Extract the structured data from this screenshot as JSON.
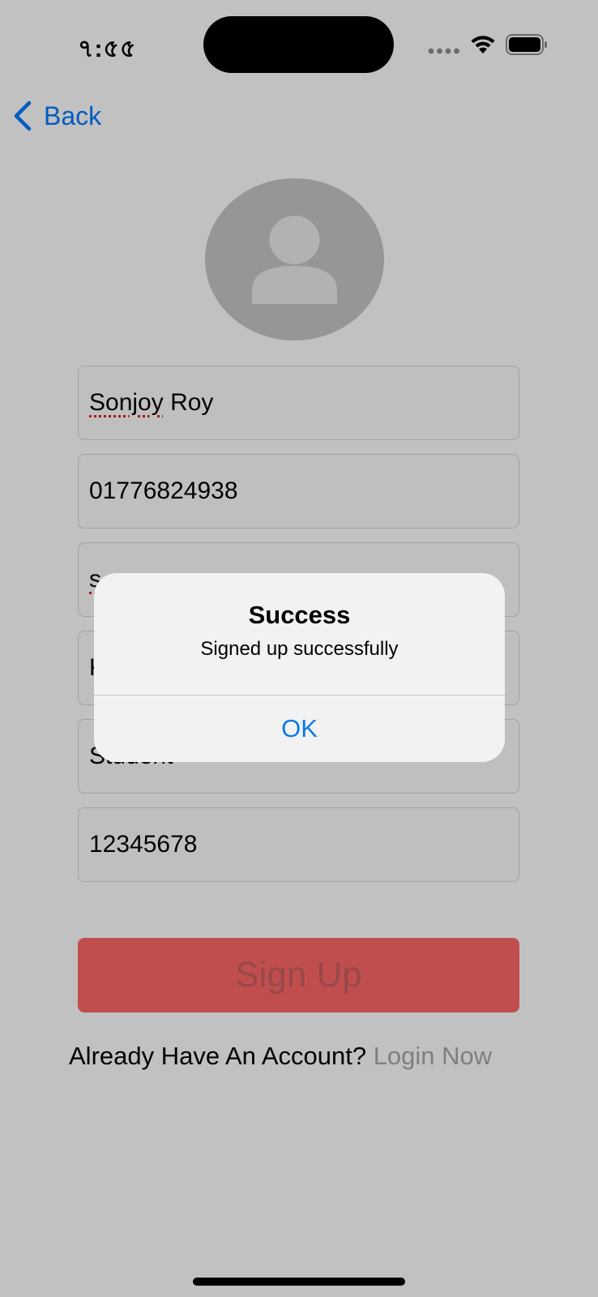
{
  "status_bar": {
    "time": "৭:৫৫",
    "signal_icon": "cellular-signal-icon",
    "wifi_icon": "wifi-icon",
    "battery_icon": "battery-icon"
  },
  "nav": {
    "back_label": "Back",
    "back_icon": "chevron-left-icon"
  },
  "avatar": {
    "icon": "person-icon"
  },
  "form": {
    "name_value": "Sonjoy Roy",
    "name_first": "Sonjoy",
    "name_rest": " Roy",
    "phone_value": "01776824938",
    "email_visible": "s",
    "field4_visible": "K",
    "role_value": "Student",
    "password_value": "12345678"
  },
  "signup_button": {
    "label": "Sign Up"
  },
  "login_prompt": {
    "text": "Already Have An Account? ",
    "link": "Login Now"
  },
  "alert": {
    "title": "Success",
    "message": "Signed up successfully",
    "ok_label": "OK"
  },
  "colors": {
    "accent_blue": "#007aff",
    "signup_red": "#ff6868",
    "login_link_gray": "#a8a8a8"
  }
}
